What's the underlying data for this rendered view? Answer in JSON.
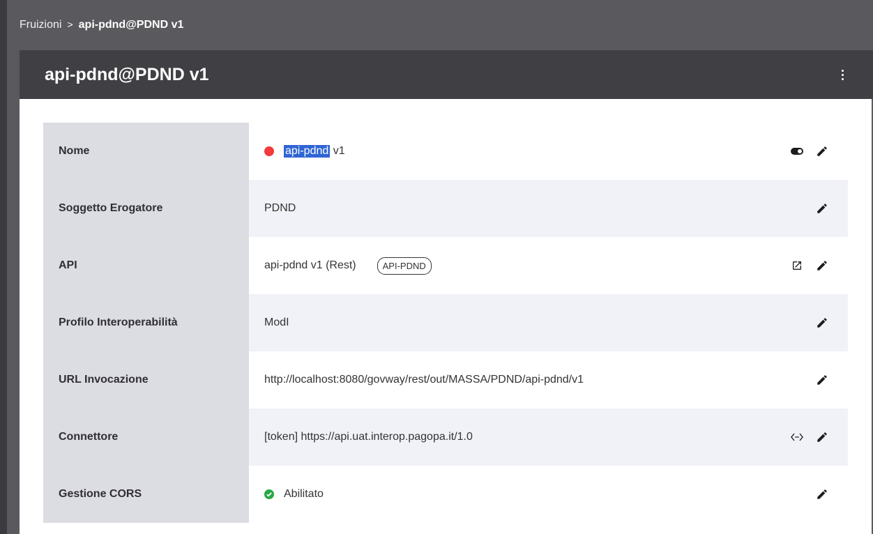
{
  "breadcrumb": {
    "root": "Fruizioni",
    "separator": ">",
    "current": "api-pdnd@PDND v1"
  },
  "panel": {
    "title": "api-pdnd@PDND v1"
  },
  "colors": {
    "status_red": "#f43a3a",
    "enabled_green": "#27a844",
    "highlight": "#2f65d4"
  },
  "rows": {
    "nome": {
      "label": "Nome",
      "value_highlight": "api-pdnd",
      "value_rest": " v1",
      "status": "red-dot"
    },
    "soggetto": {
      "label": "Soggetto Erogatore",
      "value": "PDND"
    },
    "api": {
      "label": "API",
      "value": "api-pdnd v1 (Rest)",
      "tag": "API-PDND"
    },
    "profilo": {
      "label": "Profilo Interoperabilità",
      "value": "ModI"
    },
    "url": {
      "label": "URL Invocazione",
      "value": "http://localhost:8080/govway/rest/out/MASSA/PDND/api-pdnd/v1"
    },
    "connettore": {
      "label": "Connettore",
      "value": "[token] https://api.uat.interop.pagopa.it/1.0"
    },
    "cors": {
      "label": "Gestione CORS",
      "value": "Abilitato"
    }
  }
}
